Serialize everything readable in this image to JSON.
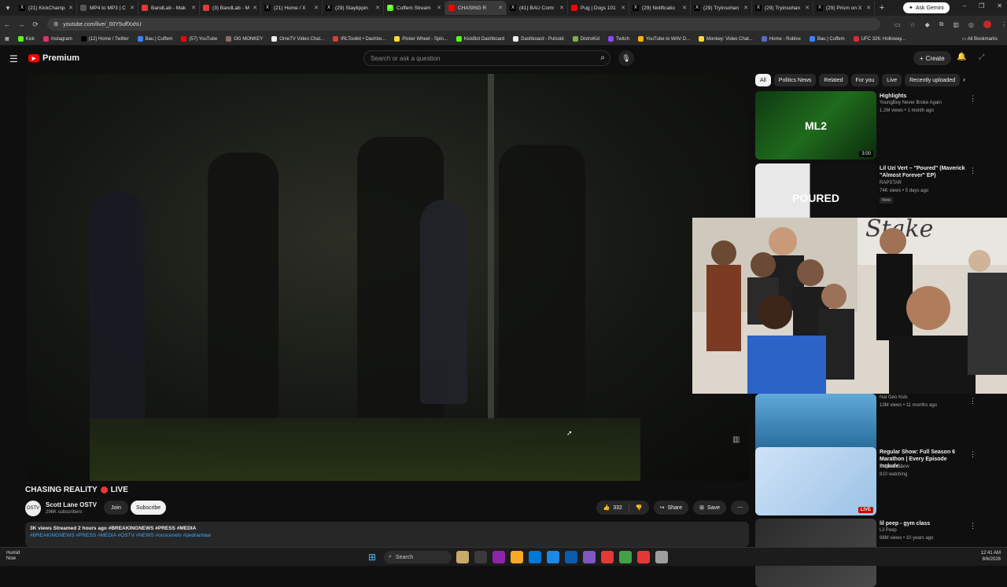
{
  "browser": {
    "tabs": [
      {
        "label": "(21) KickChamp",
        "color": "#000000",
        "glyph": "X"
      },
      {
        "label": "MP4 to MP3 | C",
        "color": "#555555",
        "glyph": ""
      },
      {
        "label": "BandLab - Mak",
        "color": "#e53935",
        "glyph": ""
      },
      {
        "label": "(3) BandLab - M",
        "color": "#e53935",
        "glyph": ""
      },
      {
        "label": "(21) Home / X",
        "color": "#000000",
        "glyph": "X"
      },
      {
        "label": "(29) Staytippin",
        "color": "#000000",
        "glyph": "X"
      },
      {
        "label": "Cuffem Stream",
        "color": "#53fc18",
        "glyph": "K"
      },
      {
        "label": "CHASING R",
        "color": "#ff0000",
        "glyph": ""
      },
      {
        "label": "(41) BAU Comr",
        "color": "#000000",
        "glyph": "X"
      },
      {
        "label": "Pug | Dogs 101",
        "color": "#ff0000",
        "glyph": ""
      },
      {
        "label": "(29) Notificatio",
        "color": "#000000",
        "glyph": "X"
      },
      {
        "label": "(29) Tryinsohan",
        "color": "#000000",
        "glyph": "X"
      },
      {
        "label": "(29) Tryinsohan",
        "color": "#000000",
        "glyph": "X"
      },
      {
        "label": "(29) Prism on X",
        "color": "#000000",
        "glyph": "X"
      }
    ],
    "ask_gemini": "Ask Gemini",
    "url": "youtube.com/live/_00Y5uffXxhU",
    "bookmarks": [
      {
        "label": "Kick",
        "color": "#53fc18"
      },
      {
        "label": "Instagram",
        "color": "#e1306c"
      },
      {
        "label": "(12) Home / Twitter",
        "color": "#000000"
      },
      {
        "label": "Bau | Cuffem",
        "color": "#3b82f6"
      },
      {
        "label": "(57) YouTube",
        "color": "#ff0000"
      },
      {
        "label": "OG MONKEY",
        "color": "#8d6e63"
      },
      {
        "label": "OmeTV Video Chat...",
        "color": "#eeeeee"
      },
      {
        "label": "IRLToolkit • Dashbo...",
        "color": "#e53935"
      },
      {
        "label": "Picker Wheel - Spin...",
        "color": "#fdd835"
      },
      {
        "label": "KickBot Dashboard",
        "color": "#53fc18"
      },
      {
        "label": "Dashboard - Pulsoid",
        "color": "#eeeeee"
      },
      {
        "label": "DistroKid",
        "color": "#7cb342"
      },
      {
        "label": "Twitch",
        "color": "#9146ff"
      },
      {
        "label": "YouTube to WAV D...",
        "color": "#ffb300"
      },
      {
        "label": "Monkey: Video Chat...",
        "color": "#fdd835"
      },
      {
        "label": "Home - Roblox",
        "color": "#5c6bc0"
      },
      {
        "label": "Bau | Cuffem",
        "color": "#3b82f6"
      },
      {
        "label": "UFC 326: Holloway...",
        "color": "#d32f2f"
      }
    ],
    "all_bookmarks": "All Bookmarks"
  },
  "youtube": {
    "logo_text": "Premium",
    "search_placeholder": "Search or ask a question",
    "create_label": "Create",
    "video": {
      "title": "CHASING REALITY",
      "live_label": "LIVE",
      "channel_initials": "OSTV",
      "channel_name": "Scott Lane OSTV",
      "subscribers": "296K subscribers",
      "join_label": "Join",
      "subscribe_label": "Subscribe",
      "likes": "332",
      "share_label": "Share",
      "save_label": "Save",
      "description_meta": "3K views  Streamed 2 hours ago  #BREAKINGNEWS #PRESS #MEDIA",
      "description_tags": "#BREAKINGNEWS #PRESS #MEDIA #OSTV #NEWS #onscenetv #pedramlaw"
    },
    "chips": [
      "All",
      "Politics News",
      "Related",
      "For you",
      "Live",
      "Recently uploaded"
    ],
    "recommendations": [
      {
        "title": "Highlights",
        "channel": "YoungBoy Never Broke Again",
        "meta": "1.2M views • 1 month ago",
        "duration": "3:00",
        "thumb": "linear-gradient(135deg,#0f3a12,#1f6b1c 50%,#0c2b0d)",
        "thumb_text": "ML2",
        "badge": "",
        "live": false
      },
      {
        "title": "Lil Uzi Vert – \"Poured\" (Maverick \"Almost Forever\" EP)",
        "channel": "RAPSTAR",
        "meta": "74K views • 5 days ago",
        "duration": "",
        "thumb": "linear-gradient(90deg,#e8e8e8 45%,#111 45%)",
        "thumb_text": "POURED",
        "badge": "New",
        "live": false
      },
      {
        "title": "",
        "channel": "Nat Geo Kids",
        "meta": "13M views • 11 months ago",
        "duration": "42:32",
        "thumb": "linear-gradient(180deg,#5fa9d8,#1b5e8e)",
        "thumb_text": "",
        "badge": "",
        "live": false
      },
      {
        "title": "Regular Show: Full Season 6 Marathon | Every Episode Include...",
        "channel": "Regular Show",
        "meta": "810 watching",
        "duration": "",
        "thumb": "linear-gradient(135deg,#cfe3f7,#9bc2e6)",
        "thumb_text": "",
        "badge": "",
        "live": true,
        "live_text": "LIVE"
      },
      {
        "title": "lil peep - gym class",
        "channel": "Lil Peep",
        "meta": "98M views • 10 years ago",
        "duration": "",
        "thumb": "linear-gradient(135deg,#2b2b2b,#4a4a4a)",
        "thumb_text": "",
        "badge": "",
        "live": false
      }
    ]
  },
  "taskbar": {
    "weather_temp": "Humid",
    "weather_sub": "Now",
    "search_label": "Search",
    "time": "12:41 AM",
    "date": "8/6/2026",
    "app_colors": [
      "#c8a96b",
      "#3a3a3a",
      "#8e24aa",
      "#f9a825",
      "#0078d4",
      "#1e88e5",
      "#0b5cad",
      "#7e57c2",
      "#e53935",
      "#43a047",
      "#e53935",
      "#9e9e9e"
    ]
  }
}
